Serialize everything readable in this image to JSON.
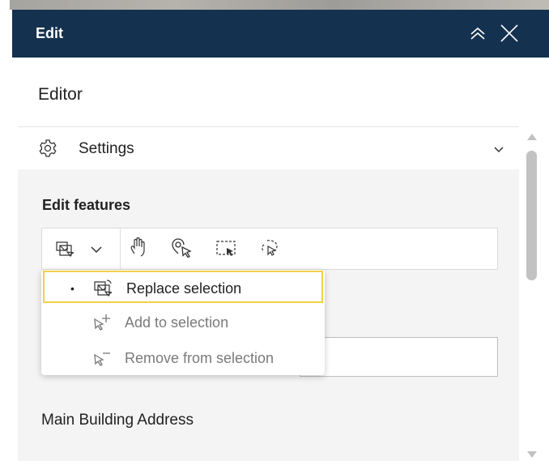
{
  "header": {
    "title": "Edit",
    "collapse_icon": "double-chevron-up-icon",
    "close_icon": "close-icon"
  },
  "panel": {
    "title": "Editor"
  },
  "settings": {
    "label": "Settings",
    "icon": "gear-icon",
    "chevron": "chevron-down-icon"
  },
  "edit_features": {
    "title": "Edit features",
    "tools": [
      "select-mode-icon",
      "pan-icon",
      "select-by-click-icon",
      "rectangle-select-icon",
      "lasso-select-icon"
    ]
  },
  "selection_menu": {
    "items": [
      {
        "label": "Replace selection",
        "selected": true,
        "icon": "replace-selection-icon"
      },
      {
        "label": "Add to selection",
        "selected": false,
        "icon": "add-selection-icon"
      },
      {
        "label": "Remove from selection",
        "selected": false,
        "icon": "remove-selection-icon"
      }
    ],
    "selected_bullet": "•"
  },
  "form": {
    "field_label": "Main Building Address"
  },
  "colors": {
    "header_bg": "#14324f",
    "focus_border": "#f1d046"
  }
}
